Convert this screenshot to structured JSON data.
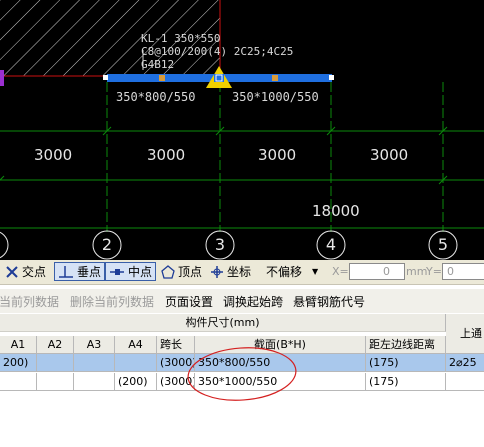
{
  "cad": {
    "beam_label_lines": [
      "KL-1 350*550",
      "C8@100/200(4) 2C25;4C25",
      "G4B12"
    ],
    "span_labels": [
      "350*800/550",
      "350*1000/550"
    ],
    "dimensions": [
      "3000",
      "3000",
      "3000",
      "3000",
      "18000"
    ],
    "axis_numbers": [
      "2",
      "3",
      "4",
      "5"
    ],
    "colors": {
      "beam": "#1f6fe0",
      "grid_line": "#0b8a0b",
      "axis_line": "#cc1111",
      "marker": "#f0d000"
    }
  },
  "snap_toolbar": {
    "items": [
      {
        "label": "交点",
        "icon": "cross-icon",
        "pressed": false
      },
      {
        "label": "垂点",
        "icon": "perpendicular-icon",
        "pressed": true
      },
      {
        "label": "中点",
        "icon": "midpoint-icon",
        "pressed": true
      },
      {
        "label": "顶点",
        "icon": "vertex-icon",
        "pressed": false
      },
      {
        "label": "坐标",
        "icon": "coordinate-icon",
        "pressed": false
      }
    ],
    "offset_select": "不偏移",
    "x_label": "X=",
    "x_value": "0",
    "unit": "mm",
    "y_label": "Y=",
    "y_value": "0"
  },
  "table_toolbar": {
    "buttons": [
      "当前列数据",
      "删除当前列数据",
      "页面设置",
      "调换起始跨",
      "悬臂钢筋代号"
    ]
  },
  "table": {
    "group_header": "构件尺寸(mm)",
    "right_header": "上通",
    "columns": [
      "A1",
      "A2",
      "A3",
      "A4",
      "跨长",
      "截面(B*H)",
      "距左边线距离"
    ],
    "rows": [
      {
        "a1": "200)",
        "a2": "",
        "a3": "",
        "a4": "",
        "span": "(3000)",
        "section": "350*800/550",
        "dist": "(175)",
        "extra": "2⌀25"
      },
      {
        "a1": "",
        "a2": "",
        "a3": "",
        "a4": "(200)",
        "span": "(3000)",
        "section": "350*1000/550",
        "dist": "(175)",
        "extra": ""
      }
    ]
  }
}
